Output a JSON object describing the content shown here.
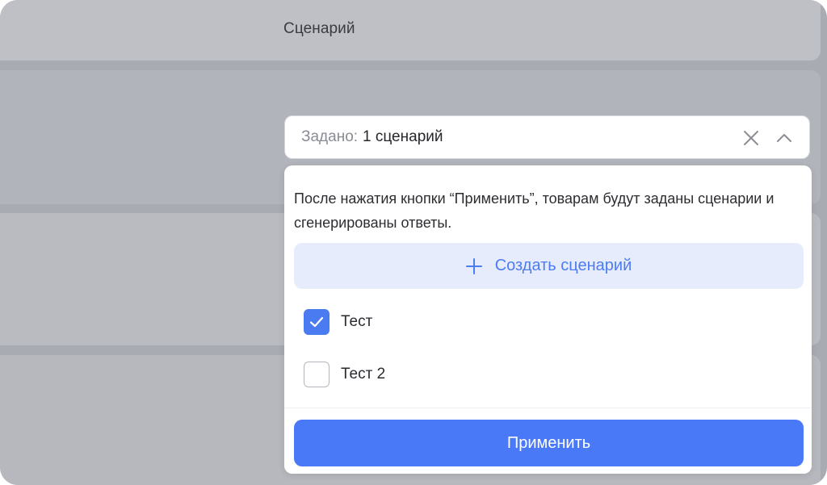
{
  "header": {
    "title": "Сценарий"
  },
  "select": {
    "label": "Задано:",
    "value": "1 сценарий",
    "clear_icon": "close-icon",
    "toggle_icon": "chevron-up-icon"
  },
  "dropdown": {
    "info_text": "После нажатия кнопки “Применить”, товарам будут заданы сценарии и сгенерированы ответы.",
    "create_button": {
      "label": "Создать сценарий",
      "icon": "plus-icon"
    },
    "options": [
      {
        "label": "Тест",
        "checked": true
      },
      {
        "label": "Тест 2",
        "checked": false
      }
    ],
    "apply_label": "Применить"
  },
  "colors": {
    "accent": "#4979f6",
    "accent_light": "#e6ecfc",
    "overlay": "#a9abb2"
  }
}
